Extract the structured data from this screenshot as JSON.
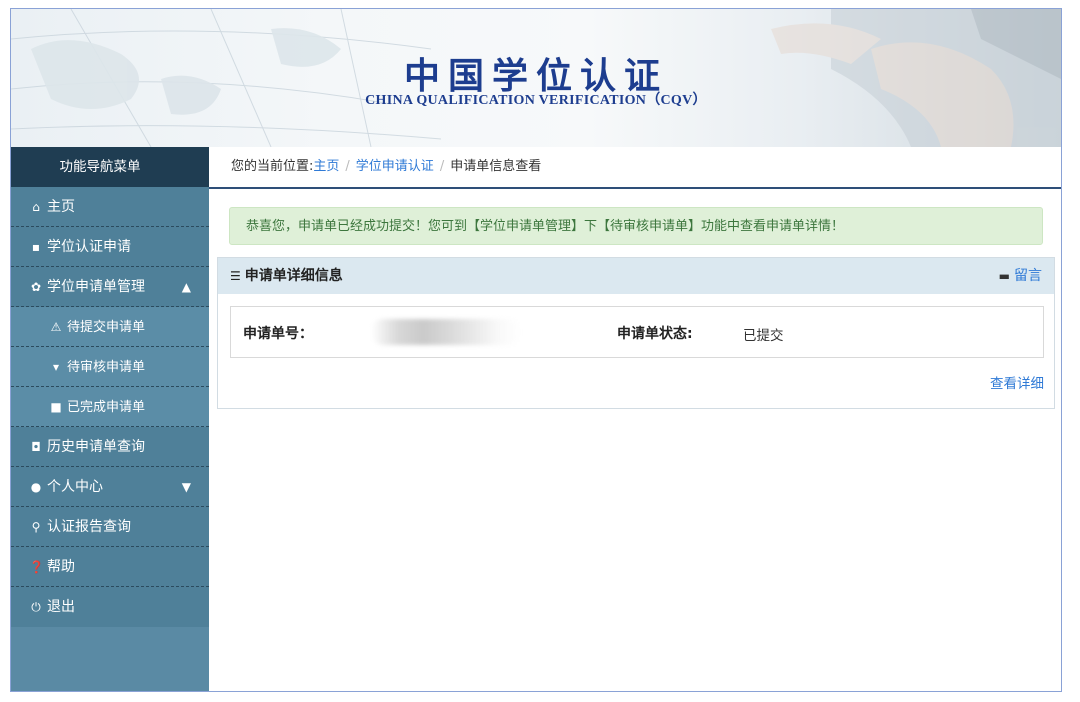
{
  "banner": {
    "title": "中国学位认证",
    "subtitle": "CHINA QUALIFICATION VERIFICATION（CQV）"
  },
  "sidebar": {
    "header": "功能导航菜单",
    "items": [
      {
        "label": "主页",
        "icon": "home-icon"
      },
      {
        "label": "学位认证申请",
        "icon": "file-icon"
      },
      {
        "label": "学位申请单管理",
        "icon": "gear-icon",
        "chevron": "chevron-up-icon"
      },
      {
        "label": "待提交申请单",
        "icon": "warning-icon"
      },
      {
        "label": "待审核申请单",
        "icon": "cart-icon"
      },
      {
        "label": "已完成申请单",
        "icon": "briefcase-icon"
      },
      {
        "label": "历史申请单查询",
        "icon": "camera-icon"
      },
      {
        "label": "个人中心",
        "icon": "user-icon",
        "chevron": "chevron-down-icon"
      },
      {
        "label": "认证报告查询",
        "icon": "search-icon"
      },
      {
        "label": "帮助",
        "icon": "question-icon"
      },
      {
        "label": "退出",
        "icon": "power-icon"
      }
    ]
  },
  "breadcrumb": {
    "prefix": "您的当前位置:",
    "links": [
      "主页",
      "学位申请认证"
    ],
    "current": "申请单信息查看"
  },
  "alert": {
    "message": "恭喜您，申请单已经成功提交！您可到【学位申请单管理】下【待审核申请单】功能中查看申请单详情！"
  },
  "panel": {
    "title": "申请单详细信息",
    "message_link": "留言",
    "number_label": "申请单号：",
    "status_label": "申请单状态:",
    "status_value": "已提交",
    "detail_link": "查看详细"
  },
  "colors": {
    "sidebar_bg": "#4f8099",
    "sidebar_header": "#1f3d52",
    "link": "#2f7ad6",
    "title_blue": "#1d3d8f",
    "success_bg": "#dff0d8"
  }
}
